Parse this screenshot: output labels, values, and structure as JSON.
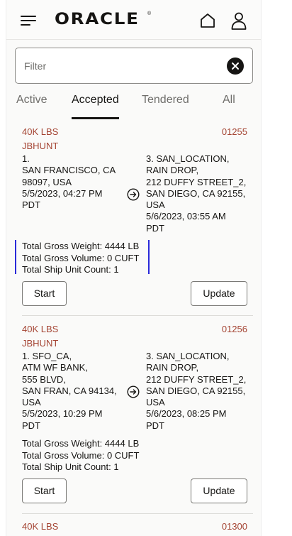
{
  "header": {
    "logo_text": "ORACLE",
    "logo_mark": "®",
    "icons": [
      "hamburger-menu-icon",
      "home-icon",
      "user-icon"
    ]
  },
  "filter": {
    "placeholder": "Filter",
    "value": ""
  },
  "tabs": [
    {
      "label": "Active",
      "active": false
    },
    {
      "label": "Accepted",
      "active": true
    },
    {
      "label": "Tendered",
      "active": false
    },
    {
      "label": "All",
      "active": false
    }
  ],
  "shipments": [
    {
      "weight": "40K LBS",
      "carrier": "JBHUNT",
      "id": "01255",
      "origin_lines": [
        "1.",
        "SAN FRANCISCO, CA",
        "98097, USA",
        "5/5/2023, 04:27 PM",
        "PDT"
      ],
      "destination_lines": [
        "3. SAN_LOCATION,",
        "RAIN DROP,",
        "212 DUFFY STREET_2,",
        "SAN DIEGO, CA 92155,",
        "USA",
        "5/6/2023, 03:55 AM",
        "PDT"
      ],
      "totals": [
        "Total Gross Weight: 4444 LB",
        "Total Gross Volume: 0 CUFT",
        "Total Ship Unit Count: 1"
      ],
      "start_label": "Start",
      "update_label": "Update"
    },
    {
      "weight": "40K LBS",
      "carrier": "JBHUNT",
      "id": "01256",
      "origin_lines": [
        "1. SFO_CA,",
        "ATM WF BANK,",
        "555 BLVD,",
        "SAN FRAN, CA 94134,",
        "USA",
        "5/5/2023, 10:29 PM",
        "PDT"
      ],
      "destination_lines": [
        "3. SAN_LOCATION,",
        "RAIN DROP,",
        "212 DUFFY STREET_2,",
        "SAN DIEGO, CA 92155,",
        "USA",
        "5/6/2023, 08:25 PM",
        "PDT"
      ],
      "totals": [
        "Total Gross Weight: 4444 LB",
        "Total Gross Volume: 0 CUFT",
        "Total Ship Unit Count: 1"
      ],
      "start_label": "Start",
      "update_label": "Update"
    },
    {
      "weight": "40K LBS",
      "id": "01300"
    }
  ],
  "colors": {
    "accent_text": "#a44433",
    "focus_outline": "#2a2ad9",
    "primary_text": "#161513"
  }
}
